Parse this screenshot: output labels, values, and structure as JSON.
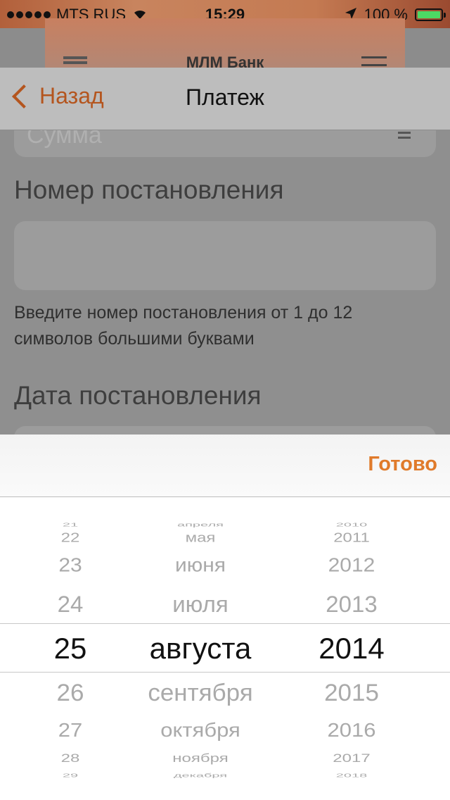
{
  "status": {
    "carrier": "MTS RUS",
    "time": "15:29",
    "battery": "100 %"
  },
  "background_app": {
    "title": "МЛМ Банк"
  },
  "nav": {
    "back_label": "Назад",
    "title": "Платеж"
  },
  "form": {
    "sum_placeholder": "Сумма",
    "number_label": "Номер постановления",
    "number_value": "",
    "number_hint": "Введите номер постановления от 1 до 12 символов  большими буквами",
    "date_label": "Дата постановления"
  },
  "picker": {
    "done_label": "Готово",
    "days": [
      "21",
      "22",
      "23",
      "24",
      "25",
      "26",
      "27",
      "28",
      "29"
    ],
    "months": [
      "апреля",
      "мая",
      "июня",
      "июля",
      "августа",
      "сентября",
      "октября",
      "ноября",
      "декабря"
    ],
    "years": [
      "2010",
      "2011",
      "2012",
      "2013",
      "2014",
      "2015",
      "2016",
      "2017",
      "2018"
    ],
    "selected": {
      "day": "25",
      "month": "августа",
      "year": "2014"
    }
  },
  "colors": {
    "accent": "#e07a2a",
    "back": "#b4551e",
    "battery": "#4cd964"
  }
}
